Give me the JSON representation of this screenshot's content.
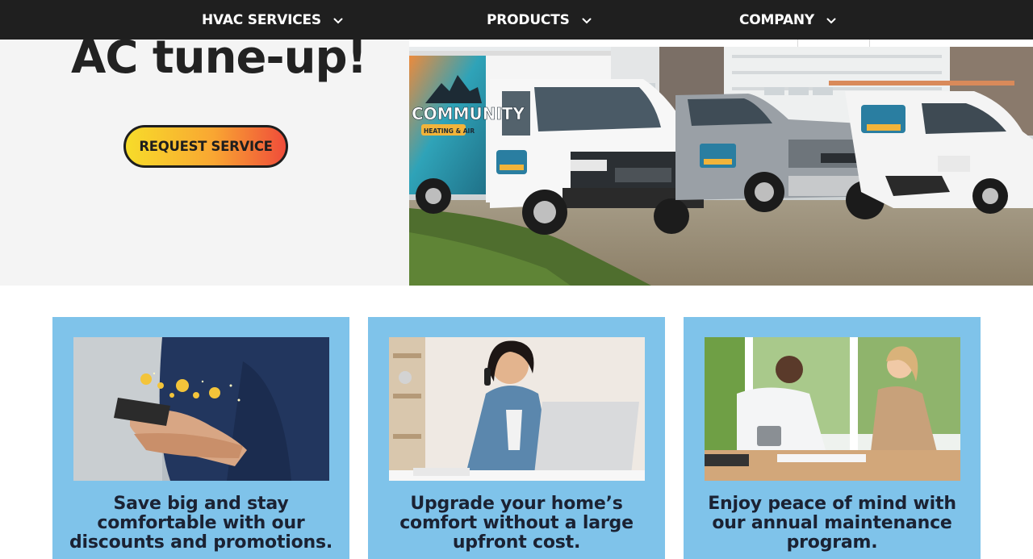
{
  "nav": {
    "items": [
      {
        "label": "HVAC SERVICES",
        "icon": "chevron-down-icon"
      },
      {
        "label": "PRODUCTS",
        "icon": "chevron-down-icon"
      },
      {
        "label": "COMPANY",
        "icon": "chevron-down-icon"
      }
    ]
  },
  "hero": {
    "title": "AC tune-up!",
    "cta_label": "REQUEST SERVICE",
    "photo_truck_logo": "COMMUNITY",
    "photo_truck_sub": "HEATING & AIR"
  },
  "cards": [
    {
      "text": "Save big and stay comfortable with our discounts and promotions."
    },
    {
      "text": "Upgrade your home’s comfort without a large upfront cost."
    },
    {
      "text": "Enjoy peace of mind with our annual maintenance program."
    }
  ],
  "colors": {
    "nav_bg": "#1f1f1f",
    "hero_bg": "#f4f4f4",
    "card_bg": "#7fc3ea",
    "cta_gradient_start": "#f7dc2a",
    "cta_gradient_end": "#ef4c3a"
  }
}
